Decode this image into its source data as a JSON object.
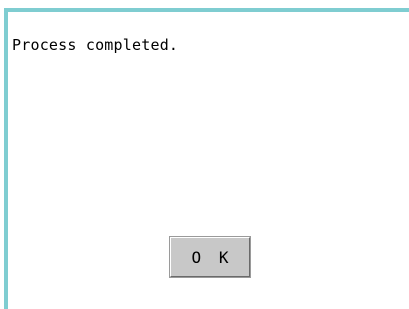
{
  "dialog": {
    "message": "Process completed.",
    "ok_label": "O K",
    "frame_color": "#7fcdd1",
    "button_color": "#c8c8c8"
  }
}
